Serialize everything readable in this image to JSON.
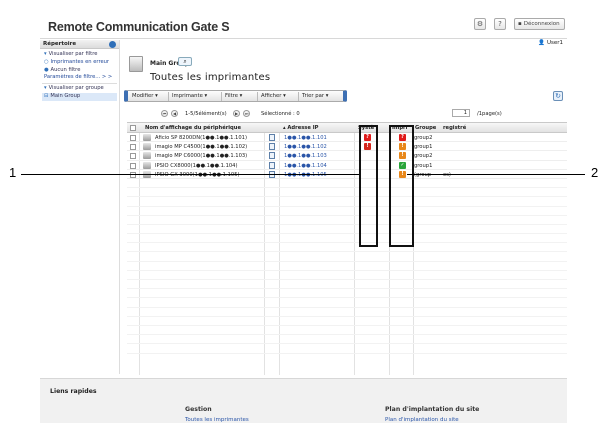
{
  "app": {
    "title": "Remote Communication Gate S",
    "logout_label": "Déconnexion",
    "user": "User1"
  },
  "sidebar": {
    "heading": "Répertoire",
    "items": [
      {
        "label": "Visualiser par filtre",
        "bullet": "▾"
      },
      {
        "label": "Imprimantes en erreur",
        "bullet": "○"
      },
      {
        "label": "Aucun filtre",
        "bullet": "●"
      },
      {
        "label": "Paramètres de filtre... > >",
        "bullet": ""
      },
      {
        "label": "Visualiser par groupe",
        "bullet": "▾"
      },
      {
        "label": "Main Group",
        "bullet": "⊟"
      }
    ]
  },
  "main": {
    "group_name": "Main Group",
    "page_title": "Toutes les imprimantes",
    "toolbar": [
      "Modifier ▾",
      "Imprimante ▾",
      "Filtre ▾",
      "Afficher ▾",
      "Trier par ▾"
    ],
    "pager": {
      "range": "1-5/5élément(s)",
      "selected": "Sélectionné : 0",
      "page_value": "1",
      "per_page": "/1page(s)"
    },
    "columns": {
      "name": "Nom d'affichage du périphérique",
      "ip": "▴ Adresse IP",
      "system": "Systè",
      "printer": "Impri",
      "group": "Groupe",
      "registered": "registré"
    },
    "rows": [
      {
        "name": "Aficio SP 8200DN(1●●.1●●.1.101)",
        "ip": "1●●.1●●.1.101",
        "system": "?",
        "system_color": "#e01b1b",
        "printer": "?",
        "printer_color": "#e01b1b",
        "group": "group2",
        "registered": ""
      },
      {
        "name": "imagio MP C4500(1●●.1●●.1.102)",
        "ip": "1●●.1●●.1.102",
        "system": "!",
        "system_color": "#d4261c",
        "printer": "!",
        "printer_color": "#e8871a",
        "group": "group1",
        "registered": ""
      },
      {
        "name": "imagio MP C6000(1●●.1●●.1.103)",
        "ip": "1●●.1●●.1.103",
        "system": "",
        "system_color": "",
        "printer": "!",
        "printer_color": "#e8871a",
        "group": "group2",
        "registered": ""
      },
      {
        "name": "IPSIO CX8000(1●●.1●●.1.104)",
        "ip": "1●●.1●●.1.104",
        "system": "",
        "system_color": "",
        "printer": "✓",
        "printer_color": "#2aa43a",
        "group": "group1",
        "registered": ""
      },
      {
        "name": "IPSIO GX 3000(1●●.1●●.1.105)",
        "ip": "1●●.1●●.1.105",
        "system": "",
        "system_color": "",
        "printer": "!",
        "printer_color": "#e8871a",
        "group": "(group",
        "registered": "es)"
      }
    ]
  },
  "footer": {
    "quick_links": "Liens rapides",
    "col1_heading": "Gestion",
    "col1_link": "Toutes les imprimantes",
    "col2_heading": "Plan d'implantation du site",
    "col2_link": "Plan d'implantation du site"
  },
  "callouts": [
    "1",
    "2"
  ]
}
